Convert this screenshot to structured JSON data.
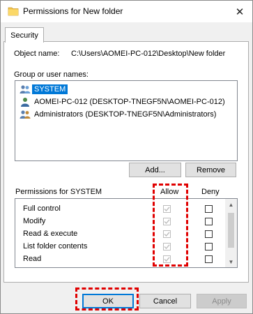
{
  "window": {
    "title": "Permissions for New folder",
    "close_glyph": "✕",
    "title_icon": "folder-icon"
  },
  "tabs": [
    {
      "label": "Security"
    }
  ],
  "object": {
    "label": "Object name:",
    "value": "C:\\Users\\AOMEI-PC-012\\Desktop\\New folder"
  },
  "group": {
    "label": "Group or user names:",
    "users": [
      {
        "name": "SYSTEM",
        "selected": true,
        "icon": "users-group-icon"
      },
      {
        "name": "AOMEI-PC-012 (DESKTOP-TNEGF5N\\AOMEI-PC-012)",
        "selected": false,
        "icon": "user-icon"
      },
      {
        "name": "Administrators (DESKTOP-TNEGF5N\\Administrators)",
        "selected": false,
        "icon": "users-group-icon"
      }
    ],
    "add_button": "Add...",
    "remove_button": "Remove"
  },
  "permissions": {
    "header": "Permissions for SYSTEM",
    "allow_header": "Allow",
    "deny_header": "Deny",
    "rows": [
      {
        "name": "Full control",
        "allow": true,
        "deny": false
      },
      {
        "name": "Modify",
        "allow": true,
        "deny": false
      },
      {
        "name": "Read & execute",
        "allow": true,
        "deny": false
      },
      {
        "name": "List folder contents",
        "allow": true,
        "deny": false
      },
      {
        "name": "Read",
        "allow": true,
        "deny": false
      }
    ]
  },
  "footer": {
    "ok": "OK",
    "cancel": "Cancel",
    "apply": "Apply"
  },
  "colors": {
    "highlight": "#0078d7",
    "annotation": "#e00000",
    "disabled_check": "#bcbcbc"
  }
}
